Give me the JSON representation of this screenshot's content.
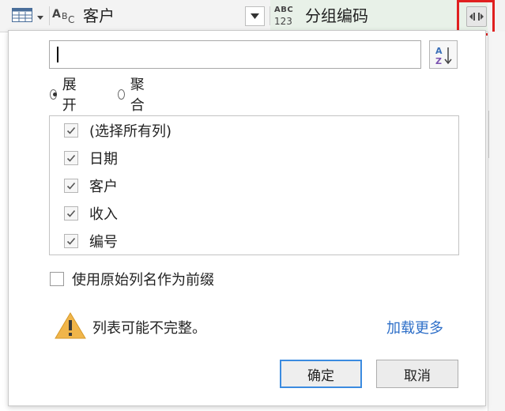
{
  "header": {
    "column1_name": "客户",
    "column2_name": "分组编码",
    "type_abc": {
      "a": "A",
      "b": "B",
      "c": "C"
    },
    "type_abc123": {
      "top": "ABC",
      "bottom": "123"
    },
    "icons": {
      "table": "table-icon",
      "caret": "caret-down-icon",
      "filter_dropdown": "dropdown-arrow-icon",
      "expand": "expand-columns-icon"
    }
  },
  "popup": {
    "search": {
      "value": "",
      "placeholder": ""
    },
    "sort_icon": "sort-az-icon",
    "mode_options": [
      {
        "label": "展开",
        "selected": true
      },
      {
        "label": "聚合",
        "selected": false
      }
    ],
    "columns": [
      {
        "label": "(选择所有列)",
        "checked": true
      },
      {
        "label": "日期",
        "checked": true
      },
      {
        "label": "客户",
        "checked": true
      },
      {
        "label": "收入",
        "checked": true
      },
      {
        "label": "编号",
        "checked": true
      }
    ],
    "prefix_option": {
      "label": "使用原始列名作为前缀",
      "checked": false
    },
    "warning": {
      "icon": "warning-icon",
      "text": "列表可能不完整。"
    },
    "load_more": "加载更多",
    "buttons": {
      "ok": "确定",
      "cancel": "取消"
    }
  },
  "colors": {
    "highlight": "#e02020",
    "link": "#2e6fc8",
    "focus": "#3b8be0",
    "green_header": "#e8f1e8",
    "warning": "#f0b54a"
  }
}
